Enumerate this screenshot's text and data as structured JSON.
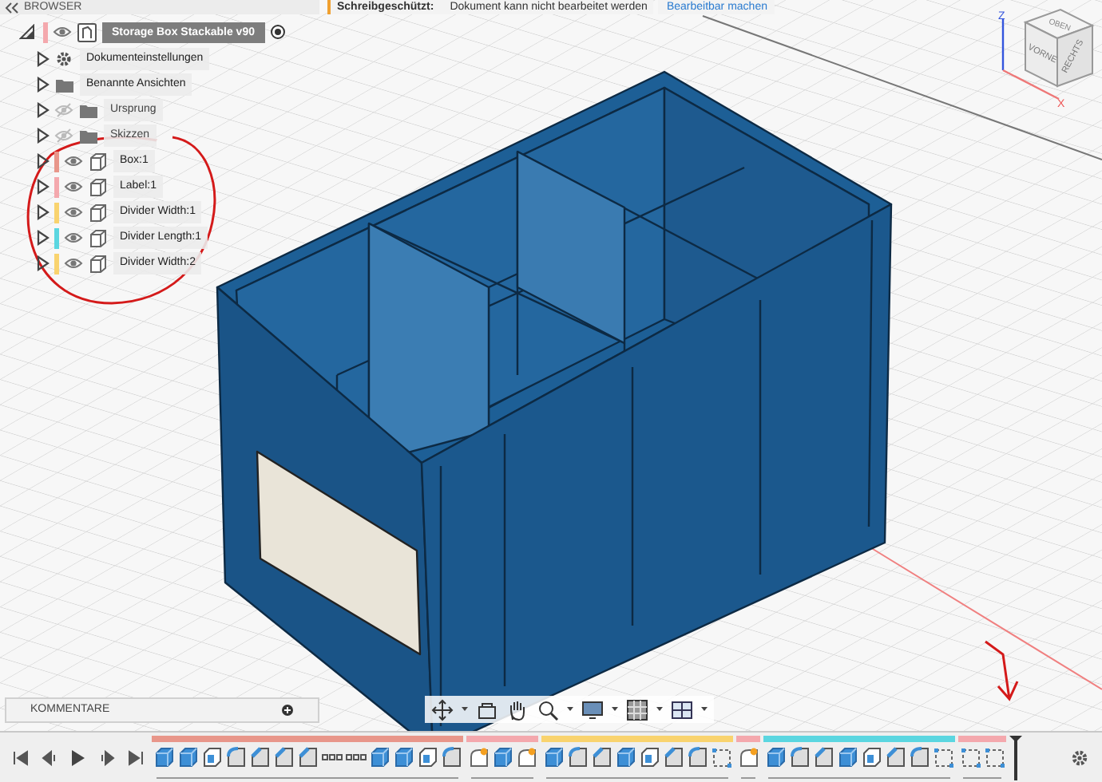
{
  "browser": {
    "title": "BROWSER",
    "root": {
      "label": "Storage Box Stackable v90",
      "visible": true,
      "color": "#f4a8ad"
    },
    "items": [
      {
        "kind": "settings",
        "label": "Dokumenteinstellungen"
      },
      {
        "kind": "folder",
        "label": "Benannte Ansichten"
      },
      {
        "kind": "folder",
        "label": "Ursprung",
        "visible": false
      },
      {
        "kind": "folder",
        "label": "Skizzen",
        "visible": false
      },
      {
        "kind": "body",
        "label": "Box:1",
        "visible": true,
        "color": "#e8968a"
      },
      {
        "kind": "body",
        "label": "Label:1",
        "visible": true,
        "color": "#f4a8ad"
      },
      {
        "kind": "body",
        "label": "Divider Width:1",
        "visible": true,
        "color": "#f9d36e"
      },
      {
        "kind": "body",
        "label": "Divider Length:1",
        "visible": true,
        "color": "#5bd6e0"
      },
      {
        "kind": "body",
        "label": "Divider Width:2",
        "visible": true,
        "color": "#f9d36e"
      }
    ]
  },
  "notice": {
    "label": "Schreibgeschützt:",
    "message": "Dokument kann nicht bearbeitet werden",
    "action": "Bearbeitbar machen"
  },
  "view_cube": {
    "faces": [
      "OBEN",
      "VORNE",
      "RECHTS"
    ],
    "axes": [
      "Z",
      "X"
    ]
  },
  "comments": {
    "title": "KOMMENTARE"
  },
  "timeline": {
    "groups": [
      {
        "color": "#e8968a",
        "features": [
          {
            "kind": "extrude"
          },
          {
            "kind": "extrude"
          },
          {
            "kind": "shell"
          },
          {
            "kind": "fillet"
          },
          {
            "kind": "chamfer"
          },
          {
            "kind": "chamfer"
          },
          {
            "kind": "chamfer"
          },
          {
            "kind": "pattern"
          },
          {
            "kind": "pattern"
          },
          {
            "kind": "extrude"
          },
          {
            "kind": "extrude"
          },
          {
            "kind": "shell"
          },
          {
            "kind": "fillet"
          }
        ]
      },
      {
        "color": "#f4a8ad",
        "features": [
          {
            "kind": "sketch"
          },
          {
            "kind": "extrude"
          },
          {
            "kind": "sketch"
          }
        ]
      },
      {
        "color": "#f9d36e",
        "features": [
          {
            "kind": "extrude"
          },
          {
            "kind": "fillet"
          },
          {
            "kind": "chamfer"
          },
          {
            "kind": "extrude"
          },
          {
            "kind": "shell"
          },
          {
            "kind": "chamfer"
          },
          {
            "kind": "fillet"
          },
          {
            "kind": "plane"
          }
        ]
      },
      {
        "color": "#f4a8ad",
        "features": [
          {
            "kind": "sketch"
          }
        ]
      },
      {
        "color": "#5bd6e0",
        "features": [
          {
            "kind": "extrude"
          },
          {
            "kind": "fillet"
          },
          {
            "kind": "chamfer"
          },
          {
            "kind": "extrude"
          },
          {
            "kind": "shell"
          },
          {
            "kind": "chamfer"
          },
          {
            "kind": "fillet"
          },
          {
            "kind": "plane"
          }
        ]
      },
      {
        "color": "#f4a8ad",
        "features": [
          {
            "kind": "plane"
          },
          {
            "kind": "plane"
          }
        ]
      }
    ]
  }
}
